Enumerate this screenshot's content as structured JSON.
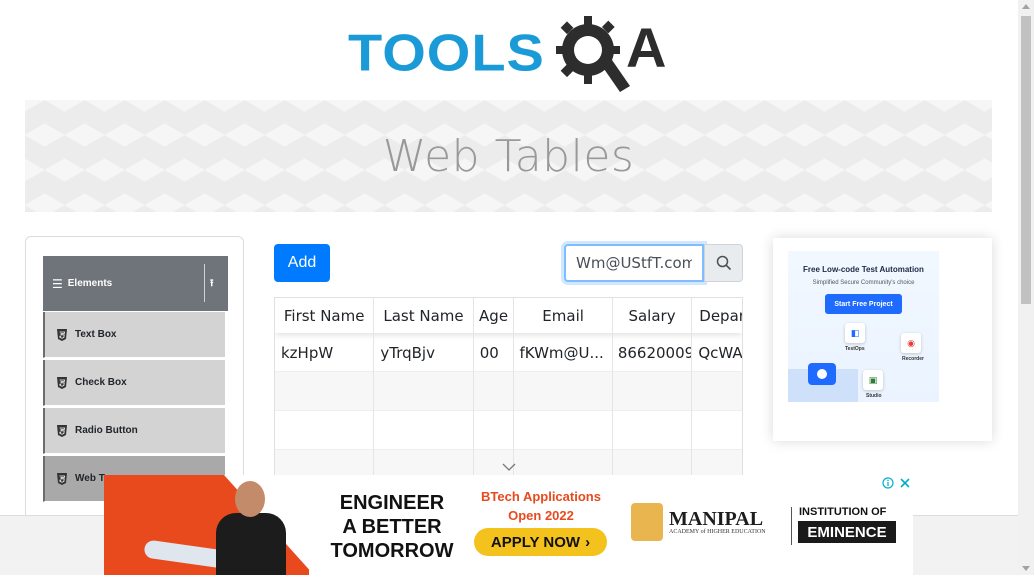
{
  "logo": {
    "text": "TOOLS",
    "suffix": "A"
  },
  "page_title": "Web Tables",
  "sidebar": {
    "group_label": "Elements",
    "items": [
      {
        "label": "Text Box"
      },
      {
        "label": "Check Box"
      },
      {
        "label": "Radio Button"
      },
      {
        "label": "Web T"
      }
    ]
  },
  "toolbar": {
    "add_label": "Add"
  },
  "search": {
    "value": "Wm@UStfT.com"
  },
  "table": {
    "headers": [
      "First Name",
      "Last Name",
      "Age",
      "Email",
      "Salary",
      "Depar"
    ],
    "rows": [
      [
        "kzHpW",
        "yTrqBjv",
        "00",
        "fKWm@U...",
        "86620009",
        "QcWA"
      ]
    ]
  },
  "side_ad": {
    "title": "Free Low-code Test Automation",
    "subtitle": "Simplified Secure Community's choice",
    "cta": "Start Free Project",
    "labels": [
      "TestOps",
      "Recorder",
      "Studio"
    ]
  },
  "bottom_ad": {
    "headline": [
      "ENGINEER",
      "A BETTER",
      "TOMORROW"
    ],
    "btech_line1": "BTech Applications",
    "btech_line2": "Open 2022",
    "apply": "APPLY NOW",
    "manipal": "MANIPAL",
    "manipal_sub": "ACADEMY of HIGHER EDUCATION",
    "institution": "INSTITUTION OF",
    "eminence": "EMINENCE"
  },
  "colors": {
    "primary": "#007bff",
    "logo_blue": "#1a9bd7",
    "sidebar_header": "#6f747a"
  }
}
